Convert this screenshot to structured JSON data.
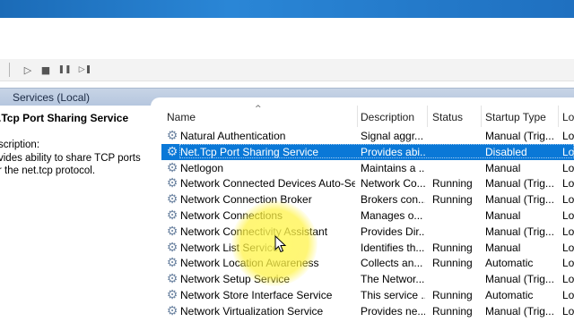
{
  "window": {
    "scope_label": "Services (Local)"
  },
  "toolbar": {
    "buttons": [
      {
        "name": "start-service-button",
        "glyph": "▷"
      },
      {
        "name": "stop-service-button",
        "glyph": "■"
      },
      {
        "name": "pause-service-button",
        "glyph": "❚❚"
      },
      {
        "name": "restart-service-button",
        "glyph": "▷❚"
      }
    ]
  },
  "details": {
    "service_title": ".Tcp Port Sharing Service",
    "description_label": "scription:",
    "description_text": "vides ability to share TCP ports\nr the net.tcp protocol."
  },
  "list": {
    "columns": {
      "name": "Name",
      "description": "Description",
      "status": "Status",
      "startup": "Startup Type",
      "logon": "Lo"
    },
    "rows": [
      {
        "name": "Natural Authentication",
        "description": "Signal aggr...",
        "status": "",
        "startup": "Manual (Trig...",
        "logon": "Lo"
      },
      {
        "name": "Net.Tcp Port Sharing Service",
        "description": "Provides abi...",
        "status": "",
        "startup": "Disabled",
        "logon": "Lo"
      },
      {
        "name": "Netlogon",
        "description": "Maintains a ...",
        "status": "",
        "startup": "Manual",
        "logon": "Lo"
      },
      {
        "name": "Network Connected Devices Auto-Se...",
        "description": "Network Co...",
        "status": "Running",
        "startup": "Manual (Trig...",
        "logon": "Lo"
      },
      {
        "name": "Network Connection Broker",
        "description": "Brokers con...",
        "status": "Running",
        "startup": "Manual (Trig...",
        "logon": "Lo"
      },
      {
        "name": "Network Connections",
        "description": "Manages o...",
        "status": "",
        "startup": "Manual",
        "logon": "Lo"
      },
      {
        "name": "Network Connectivity Assistant",
        "description": "Provides Dir...",
        "status": "",
        "startup": "Manual (Trig...",
        "logon": "Lo"
      },
      {
        "name": "Network List Service",
        "description": "Identifies th...",
        "status": "Running",
        "startup": "Manual",
        "logon": "Lo"
      },
      {
        "name": "Network Location Awareness",
        "description": "Collects an...",
        "status": "Running",
        "startup": "Automatic",
        "logon": "Lo"
      },
      {
        "name": "Network Setup Service",
        "description": "The Networ...",
        "status": "",
        "startup": "Manual (Trig...",
        "logon": "Lo"
      },
      {
        "name": "Network Store Interface Service",
        "description": "This service ...",
        "status": "Running",
        "startup": "Automatic",
        "logon": "Lo"
      },
      {
        "name": "Network Virtualization Service",
        "description": "Provides ne...",
        "status": "Running",
        "startup": "Manual (Trig...",
        "logon": "Lo"
      }
    ],
    "selected_index": 1
  },
  "colors": {
    "selection": "#0a78d7",
    "scope_bar": "#b5c6de",
    "highlight": "#fff24a"
  }
}
